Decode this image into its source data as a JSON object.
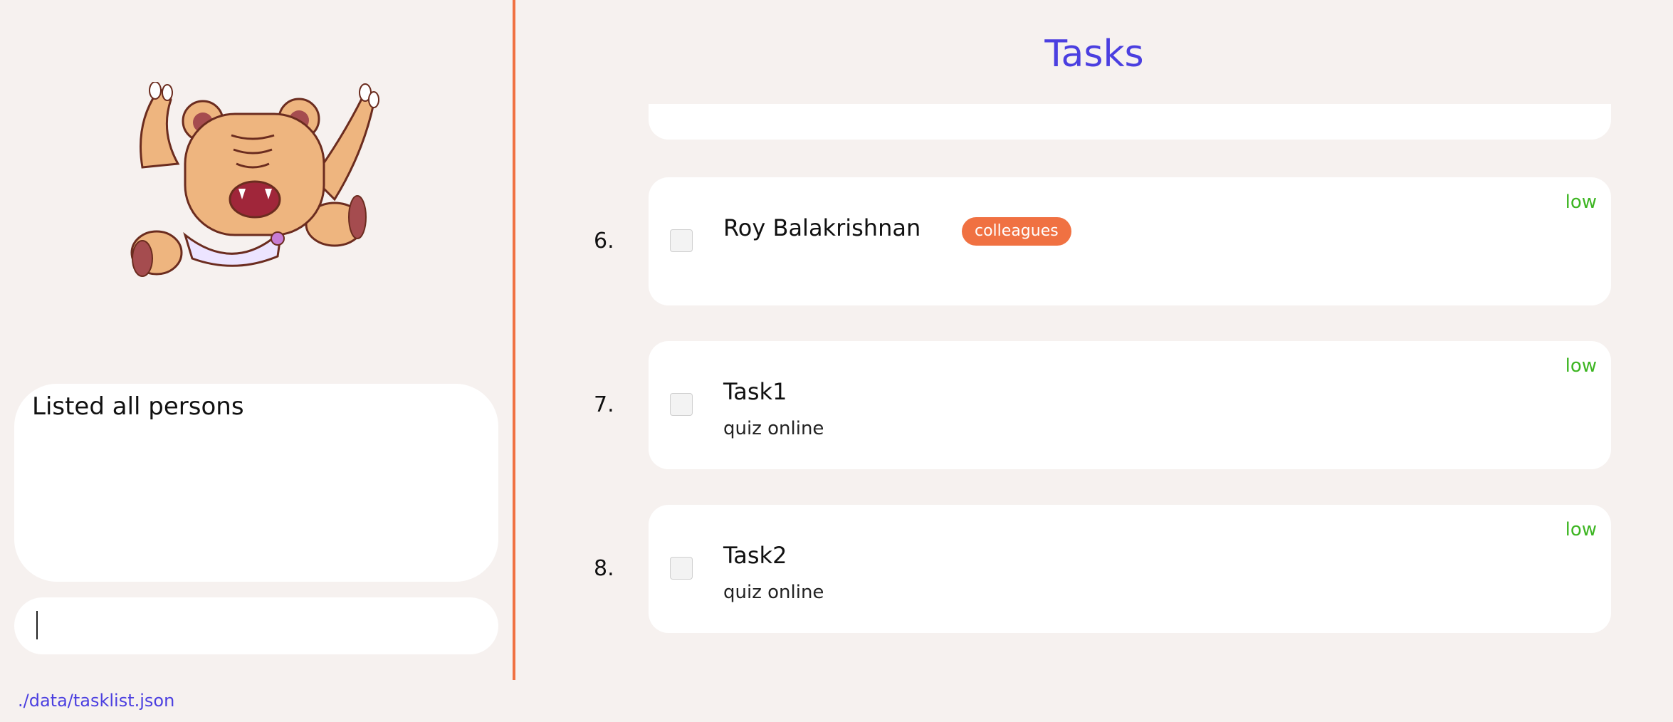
{
  "result": {
    "text": "Listed all persons"
  },
  "command": {
    "value": "",
    "placeholder": ""
  },
  "task_panel": {
    "title": "Tasks"
  },
  "tasks": [
    {
      "index": "6.",
      "name": "Roy Balakrishnan",
      "tag": "colleagues",
      "description": "",
      "priority": "low"
    },
    {
      "index": "7.",
      "name": "Task1",
      "tag": "",
      "description": "quiz online",
      "priority": "low"
    },
    {
      "index": "8.",
      "name": "Task2",
      "tag": "",
      "description": "quiz online",
      "priority": "low"
    }
  ],
  "status_bar": {
    "file_path": "./data/tasklist.json"
  },
  "colors": {
    "accent": "#4b3fe0",
    "divider": "#f07142",
    "tag": "#f07142",
    "priority_low": "#3cb521",
    "background": "#f6f1ef"
  },
  "icons": {
    "mascot": "bear-mascot-icon",
    "checkbox": "checkbox-icon"
  }
}
